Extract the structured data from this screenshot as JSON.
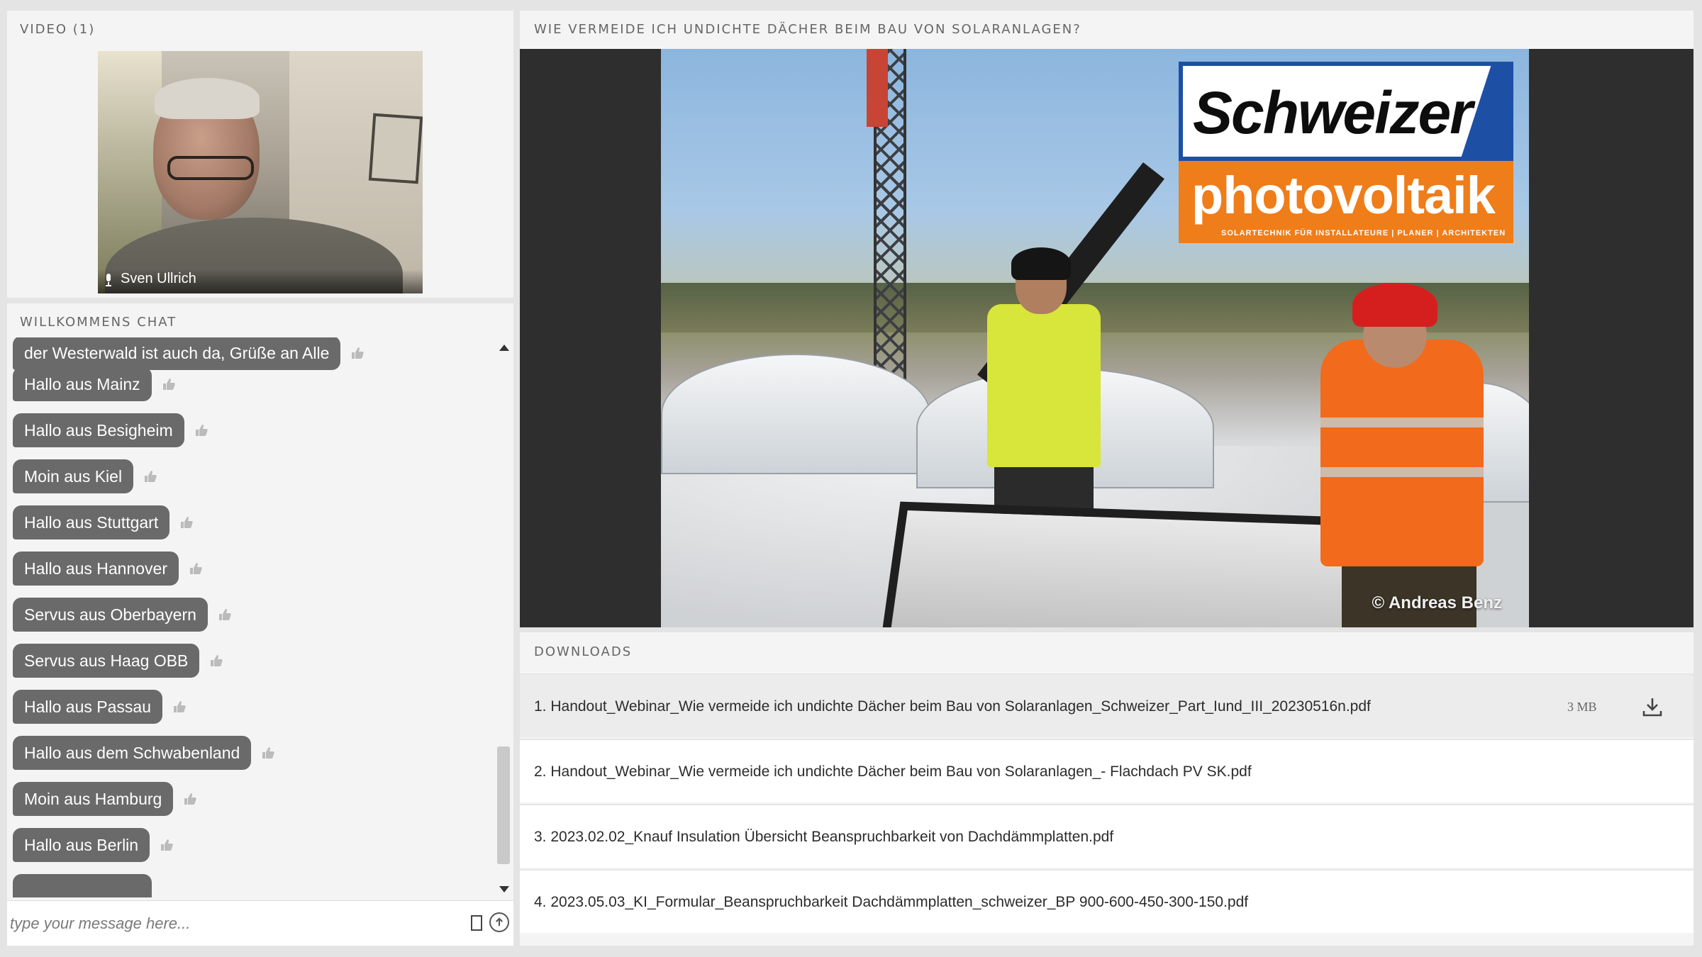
{
  "video": {
    "title": "VIDEO (1)",
    "participant_name": "Sven Ullrich"
  },
  "chat": {
    "title": "WILLKOMMENS CHAT",
    "messages": [
      "der Westerwald ist auch da, Grüße an Alle",
      "Hallo aus Mainz",
      "Hallo aus Besigheim",
      "Moin aus Kiel",
      "Hallo aus Stuttgart",
      "Hallo aus Hannover",
      "Servus aus Oberbayern",
      "Servus aus Haag OBB",
      "Hallo aus Passau",
      "Hallo aus dem Schwabenland",
      "Moin aus Hamburg",
      "Hallo aus Berlin"
    ],
    "input_placeholder": "type your message here..."
  },
  "share": {
    "title": "WIE VERMEIDE ICH UNDICHTE DÄCHER BEIM BAU VON SOLARANLAGEN?",
    "logo_brand": "Schweizer",
    "logo_sub": "photovoltaik",
    "logo_tagline": "SOLARTECHNIK FÜR INSTALLATEURE | PLANER | ARCHITEKTEN",
    "photo_credit": "© Andreas Benz"
  },
  "downloads": {
    "title": "DOWNLOADS",
    "files": [
      {
        "name": "1. Handout_Webinar_Wie vermeide ich undichte Dächer beim Bau von Solaranlagen_Schweizer_Part_Iund_III_20230516n.pdf",
        "size": "3 MB"
      },
      {
        "name": "2. Handout_Webinar_Wie vermeide ich undichte Dächer beim Bau von Solaranlagen_- Flachdach PV SK.pdf",
        "size": ""
      },
      {
        "name": "3. 2023.02.02_Knauf Insulation Übersicht Beanspruchbarkeit von Dachdämmplatten.pdf",
        "size": ""
      },
      {
        "name": "4. 2023.05.03_KI_Formular_Beanspruchbarkeit Dachdämmplatten_schweizer_BP 900-600-450-300-150.pdf",
        "size": ""
      }
    ]
  }
}
